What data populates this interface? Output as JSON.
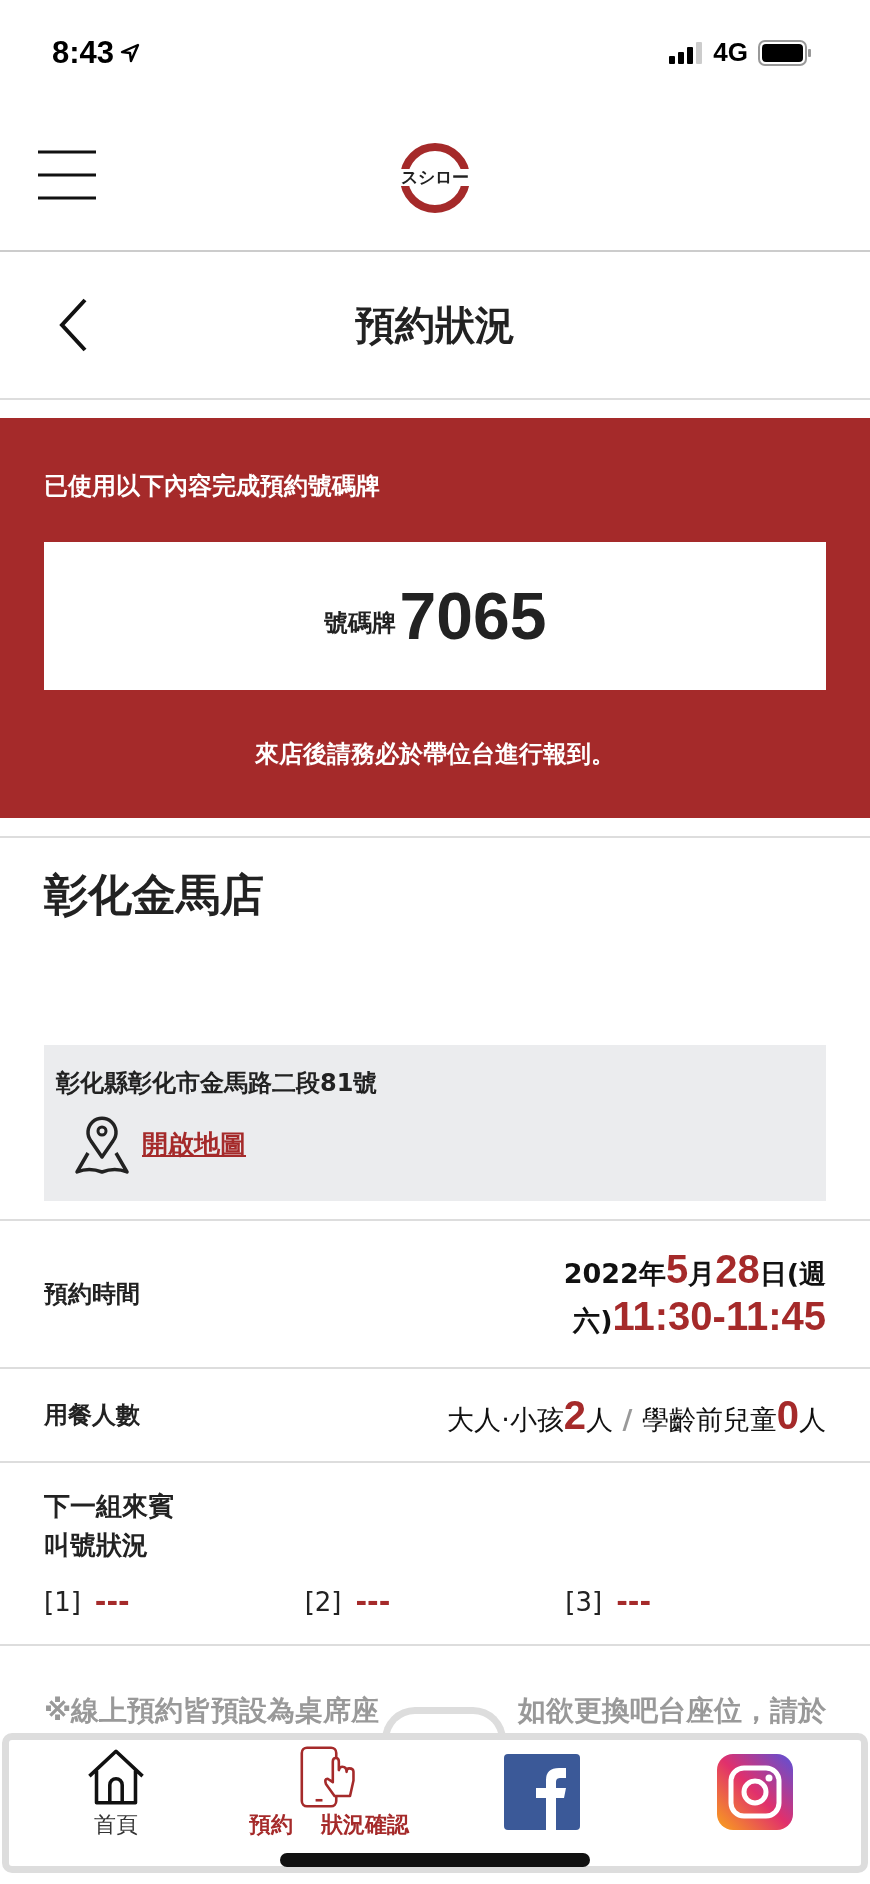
{
  "status_bar": {
    "time": "8:43",
    "network": "4G"
  },
  "header": {
    "logo": "スシロー"
  },
  "page_title": "預約狀況",
  "ticket": {
    "heading": "已使用以下內容完成預約號碼牌",
    "label": "號碼牌",
    "number": "7065",
    "note": "來店後請務必於帶位台進行報到。"
  },
  "store": {
    "name": "彰化金馬店",
    "address": "彰化縣彰化市金馬路二段81號",
    "map_link": "開啟地圖"
  },
  "details": [
    {
      "label": "預約時間",
      "kind": "time",
      "parts": [
        {
          "text": "2022",
          "kind": "plain"
        },
        {
          "text": "年",
          "kind": "plain"
        },
        {
          "text": "5",
          "kind": "number"
        },
        {
          "text": "月",
          "kind": "plain"
        },
        {
          "text": "28",
          "kind": "number"
        },
        {
          "text": "日(週六)",
          "kind": "plain"
        },
        {
          "text": "11:30-11:45",
          "kind": "number"
        }
      ]
    },
    {
      "label": "用餐人數",
      "kind": "people",
      "parts": [
        {
          "text": "大人·小孩",
          "kind": "plain"
        },
        {
          "text": "2",
          "kind": "number"
        },
        {
          "text": "人",
          "kind": "plain"
        },
        {
          "text": " / ",
          "kind": "separator"
        },
        {
          "text": "學齡前兒童",
          "kind": "plain"
        },
        {
          "text": "0",
          "kind": "number"
        },
        {
          "text": "人",
          "kind": "plain"
        }
      ]
    }
  ],
  "queue": {
    "label": [
      "下一組來賓",
      "叫號狀況"
    ],
    "slots": [
      {
        "index": "[1]",
        "value": "---"
      },
      {
        "index": "[2]",
        "value": "---"
      },
      {
        "index": "[3]",
        "value": "---"
      }
    ]
  },
  "notice": [
    "※線上預約皆預設為桌席座",
    "如欲更換吧台座位，請於"
  ],
  "bottom_nav": [
    {
      "kind": "home",
      "label": [
        "首頁"
      ],
      "selected": false
    },
    {
      "kind": "reserve",
      "label": [
        "預約",
        "狀況確認"
      ],
      "selected": true
    }
  ],
  "social_links": [
    {
      "kind": "facebook"
    },
    {
      "kind": "instagram"
    }
  ]
}
